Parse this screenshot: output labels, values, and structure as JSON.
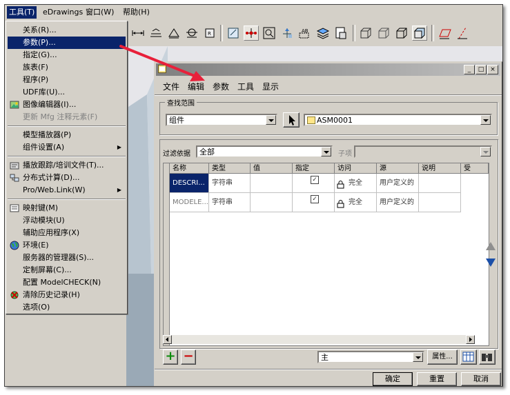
{
  "menubar": {
    "items": [
      "工具(T)",
      "eDrawings",
      "窗口(W)",
      "帮助(H)"
    ]
  },
  "tools_menu": {
    "items": [
      {
        "label": "关系(R)...",
        "icon": "none",
        "state": "normal"
      },
      {
        "label": "参数(P)...",
        "icon": "none",
        "state": "highlighted"
      },
      {
        "label": "指定(G)...",
        "icon": "none",
        "state": "normal"
      },
      {
        "label": "族表(F)",
        "icon": "none",
        "state": "normal"
      },
      {
        "label": "程序(P)",
        "icon": "none",
        "state": "normal"
      },
      {
        "label": "UDF库(U)...",
        "icon": "none",
        "state": "normal"
      },
      {
        "label": "图像编辑器(I)...",
        "icon": "image-editor-icon",
        "state": "normal"
      },
      {
        "label": "更新 Mfg 注释元素(F)",
        "icon": "none",
        "state": "disabled"
      },
      {
        "label": "模型播放器(P)",
        "icon": "none",
        "state": "normal"
      },
      {
        "label": "组件设置(A)",
        "icon": "none",
        "state": "submenu"
      },
      {
        "label": "播放跟踪/培训文件(T)...",
        "icon": "trail-file-icon",
        "state": "normal"
      },
      {
        "label": "分布式计算(D)...",
        "icon": "distributed-compute-icon",
        "state": "normal"
      },
      {
        "label": "Pro/Web.Link(W)",
        "icon": "none",
        "state": "submenu"
      },
      {
        "label": "映射键(M)",
        "icon": "mapkey-icon",
        "state": "normal"
      },
      {
        "label": "浮动模块(U)",
        "icon": "none",
        "state": "normal"
      },
      {
        "label": "辅助应用程序(X)",
        "icon": "none",
        "state": "normal"
      },
      {
        "label": "环境(E)",
        "icon": "globe-icon",
        "state": "normal"
      },
      {
        "label": "服务器的管理器(S)...",
        "icon": "none",
        "state": "normal"
      },
      {
        "label": "定制屏幕(C)...",
        "icon": "none",
        "state": "normal"
      },
      {
        "label": "配置 ModelCHECK(N)",
        "icon": "none",
        "state": "normal"
      },
      {
        "label": "清除历史记录(H)",
        "icon": "clear-history-icon",
        "state": "normal"
      },
      {
        "label": "选项(O)",
        "icon": "none",
        "state": "normal"
      }
    ]
  },
  "dialog": {
    "menu": [
      "文件",
      "编辑",
      "参数",
      "工具",
      "显示"
    ],
    "window_buttons": {
      "minimize": "_",
      "maximize": "□",
      "close": "×"
    },
    "scope": {
      "group_label": "查找范围",
      "type_value": "组件",
      "object_value": "ASM0001"
    },
    "filter": {
      "label": "过滤依据",
      "value": "全部",
      "sub_label": "子项",
      "sub_value": ""
    },
    "table": {
      "headers": [
        "名称",
        "类型",
        "值",
        "指定",
        "访问",
        "源",
        "说明",
        "受"
      ],
      "rows": [
        {
          "name": "DESCRI...",
          "type": "字符串",
          "value": "",
          "designated": "✓",
          "access": "完全",
          "source": "用户定义的",
          "description": "",
          "selected_name": true
        },
        {
          "name": "MODELE...",
          "type": "字符串",
          "value": "",
          "designated": "✓",
          "access": "完全",
          "source": "用户定义的",
          "description": "",
          "selected_name": false
        }
      ]
    },
    "bottom": {
      "add": "+",
      "remove": "−",
      "main_select": "主",
      "properties": "属性...",
      "ok": "确定",
      "reset": "重置",
      "cancel": "取消"
    }
  },
  "colors": {
    "highlight": "#0a246a",
    "face": "#d4d0c8",
    "annotation_arrow": "#e8203a"
  }
}
